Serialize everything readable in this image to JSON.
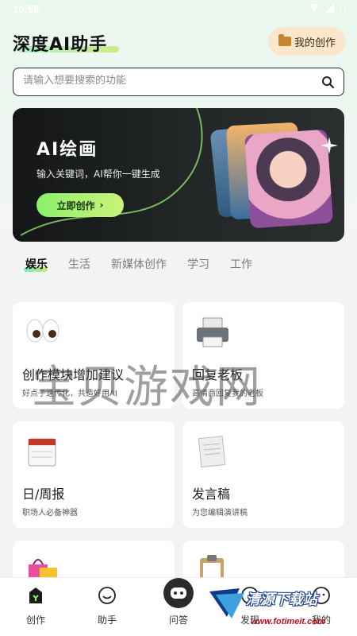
{
  "status": {
    "time": "10:58"
  },
  "header": {
    "title": "深度AI助手",
    "my_creation": "我的创作"
  },
  "search": {
    "placeholder": "请输入想要搜索的功能"
  },
  "banner": {
    "title": "AI绘画",
    "subtitle": "输入关键词，AI帮你一键生成",
    "button": "立即创作"
  },
  "tabs": [
    "娱乐",
    "生活",
    "新媒体创作",
    "学习",
    "工作"
  ],
  "active_tab": "娱乐",
  "cards": [
    {
      "title": "创作模块增加建议",
      "desc": "好点子速传化，共造好用AI",
      "icon": "eyes-icon"
    },
    {
      "title": "回复老板",
      "desc": "高情商回复我的老板",
      "icon": "printer-icon"
    },
    {
      "title": "日/周报",
      "desc": "职场人必备神器",
      "icon": "calendar-icon"
    },
    {
      "title": "发言稿",
      "desc": "为您编辑演讲稿",
      "icon": "document-icon"
    },
    {
      "title": "",
      "desc": "",
      "icon": "shopping-bag-icon"
    },
    {
      "title": "",
      "desc": "",
      "icon": "clipboard-icon"
    }
  ],
  "watermark": "宝贝游戏网",
  "nav": [
    {
      "label": "创作",
      "icon": "create-icon"
    },
    {
      "label": "助手",
      "icon": "smile-icon"
    },
    {
      "label": "问答",
      "icon": "robot-icon"
    },
    {
      "label": "发现",
      "icon": "discover-icon"
    },
    {
      "label": "我的",
      "icon": "profile-icon"
    }
  ],
  "footer_logo": {
    "text": "清源下载站",
    "url": "www.fotimeit.com"
  },
  "colors": {
    "accent_green": "#8cf06b",
    "brand_orange_bg": "#fbe7cc",
    "banner_bg": "#1b1d1e"
  }
}
